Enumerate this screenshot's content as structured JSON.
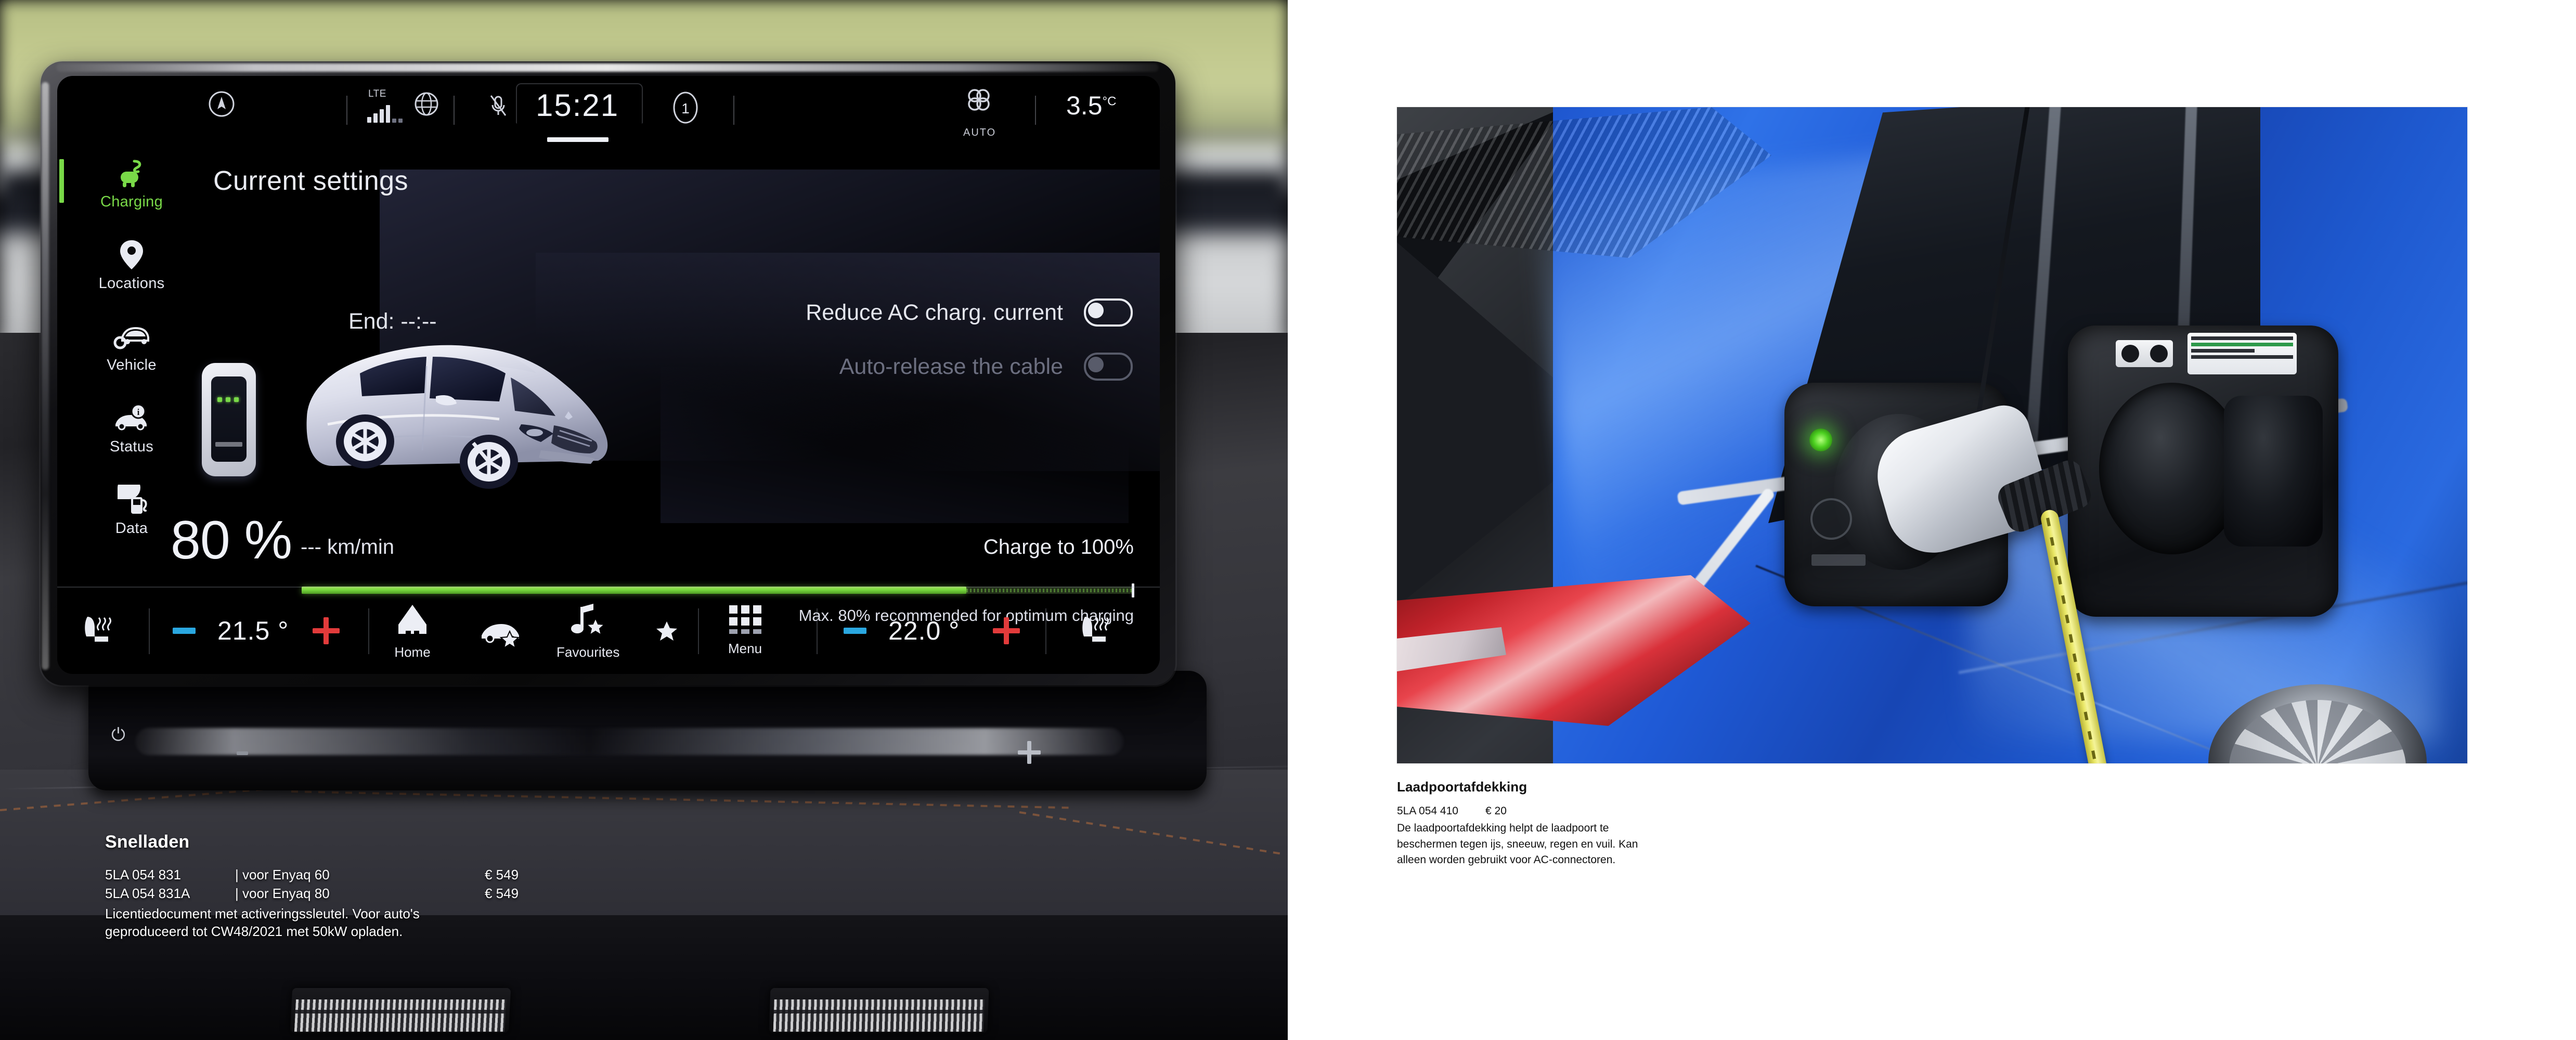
{
  "left_photo": {
    "alt": "Skoda Enyaq dashboard with infotainment screen showing charging settings",
    "infotainment": {
      "status_bar": {
        "assist_icon": "lane-assist-icon",
        "network_label": "LTE",
        "signal_icon": "signal-bars-icon",
        "globe_icon": "globe-icon",
        "phone_icon": "phone-mute-icon",
        "time": "15:21",
        "profile": "1",
        "climate_mode": "AUTO",
        "fan_icon": "fan-auto-icon",
        "outside_temp": "3.5",
        "outside_temp_unit": "°C"
      },
      "sidebar": {
        "items": [
          {
            "label": "Charging",
            "icon": "charging-plug-icon",
            "active": true
          },
          {
            "label": "Locations",
            "icon": "map-pin-icon",
            "active": false
          },
          {
            "label": "Vehicle",
            "icon": "car-gear-icon",
            "active": false
          },
          {
            "label": "Status",
            "icon": "car-info-icon",
            "active": false
          },
          {
            "label": "Data",
            "icon": "charging-data-icon",
            "active": false
          }
        ]
      },
      "main": {
        "title": "Current settings",
        "end_time_label": "End: --:--",
        "toggles": [
          {
            "label": "Reduce AC charg. current",
            "state": "off",
            "dimmed": false
          },
          {
            "label": "Auto-release the cable",
            "state": "off",
            "dimmed": true
          }
        ],
        "charge": {
          "percent_label": "80 %",
          "rate_label": "--- km/min",
          "target_label": "Charge to 100%",
          "note": "Max. 80% recommended for optimum charging",
          "fill_percent": 80,
          "accent_color": "#79d948"
        },
        "vehicle_illustration": {
          "car": "skoda-enyaq-suv",
          "charger": "wallbox-charger"
        }
      },
      "bottom_bar": {
        "left_seat_icon": "seat-heating-icon",
        "left_temp": "21.5 °",
        "right_temp": "22.0 °",
        "right_seat_icon": "seat-heating-icon",
        "items": [
          {
            "label": "Home",
            "icon": "home-icon"
          },
          {
            "label": "",
            "icon": "car-favourite-icon"
          },
          {
            "label": "Favourites",
            "icon": "music-star-icon"
          },
          {
            "label": "",
            "icon": "star-icon"
          },
          {
            "label": "Menu",
            "icon": "grid-menu-icon"
          }
        ],
        "minus_color": "#2aa7e0",
        "plus_color": "#e23b3b"
      }
    }
  },
  "left_caption": {
    "title": "Snelladen",
    "rows": [
      {
        "part_no": "5LA 054 831",
        "sep": "|",
        "desc": "voor Enyaq 60",
        "price": "€ 549"
      },
      {
        "part_no": "5LA 054 831A",
        "sep": "|",
        "desc": "voor Enyaq 80",
        "price": "€ 549"
      }
    ],
    "note": "Licentiedocument met activeringssleutel. Voor auto's geproduceerd tot CW48/2021 met 50kW opladen."
  },
  "right_photo": {
    "alt": "Blue Skoda Enyaq charging port with white connector plugged in and yellow cable"
  },
  "right_caption": {
    "title": "Laadpoortafdekking",
    "part_no": "5LA 054 410",
    "price": "€ 20",
    "description": "De laadpoortafdekking helpt de laadpoort te beschermen tegen ijs, sneeuw, regen en vuil. Kan alleen worden gebruikt voor AC-connectoren."
  }
}
